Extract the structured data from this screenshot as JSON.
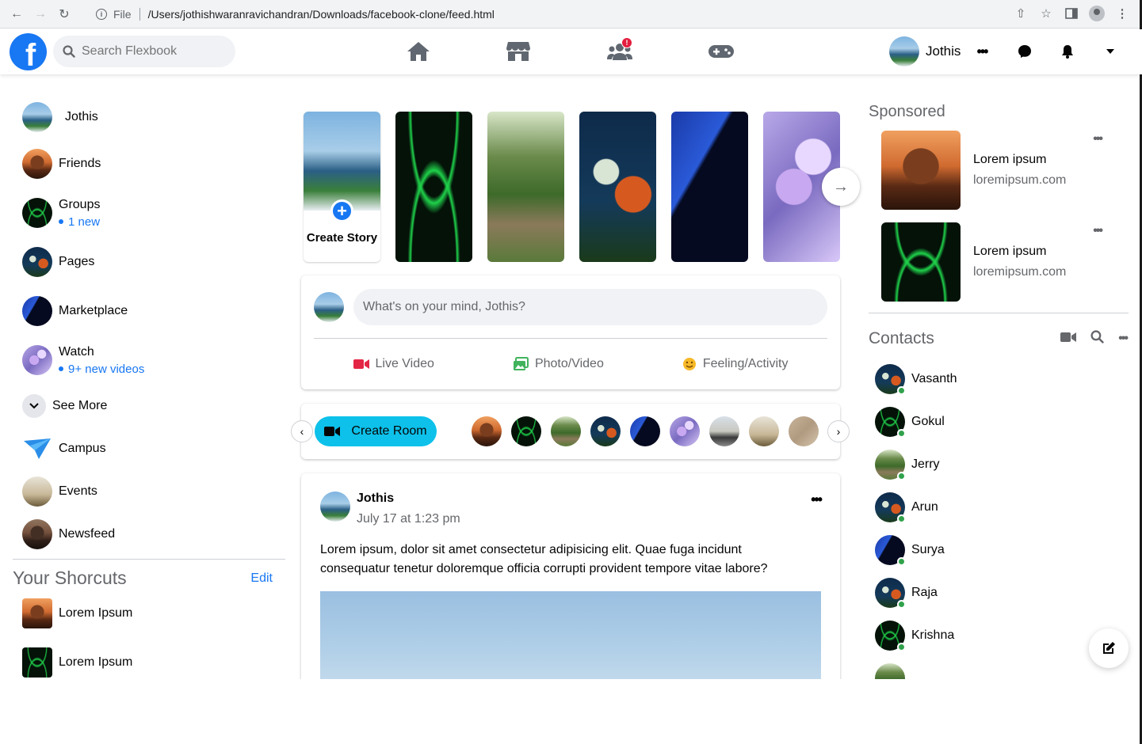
{
  "browser": {
    "protocol_label": "File",
    "url": "/Users/jothishwaranravichandran/Downloads/facebook-clone/feed.html"
  },
  "topnav": {
    "logo_letter": "f",
    "search_placeholder": "Search Flexbook",
    "groups_badge": "!",
    "profile_name": "Jothis",
    "brand_color": "#1877f2"
  },
  "left_menu": {
    "profile_name": "Jothis",
    "items": [
      {
        "label": "Friends"
      },
      {
        "label": "Groups",
        "sub": "1 new"
      },
      {
        "label": "Pages"
      },
      {
        "label": "Marketplace"
      },
      {
        "label": "Watch",
        "sub": "9+ new videos"
      }
    ],
    "see_more": "See More",
    "items2": [
      {
        "label": "Campus"
      },
      {
        "label": "Events"
      },
      {
        "label": "Newsfeed"
      }
    ],
    "shortcuts_title": "Your Shorcuts",
    "shortcuts_edit": "Edit",
    "shortcuts": [
      {
        "label": "Lorem Ipsum"
      },
      {
        "label": "Lorem Ipsum"
      }
    ]
  },
  "stories": {
    "create_label": "Create Story"
  },
  "composer": {
    "placeholder": "What's on your mind, Jothis?",
    "live_video": "Live Video",
    "photo_video": "Photo/Video",
    "feeling": "Feeling/Activity"
  },
  "rooms": {
    "create_room": "Create Room"
  },
  "post": {
    "author": "Jothis",
    "time": "July 17 at 1:23 pm",
    "text": "Lorem ipsum, dolor sit amet consectetur adipisicing elit. Quae fuga incidunt consequatur tenetur doloremque officia corrupti provident tempore vitae labore?"
  },
  "sponsored": {
    "title": "Sponsored",
    "ads": [
      {
        "title": "Lorem ipsum",
        "site": "loremipsum.com"
      },
      {
        "title": "Lorem ipsum",
        "site": "loremipsum.com"
      }
    ]
  },
  "contacts": {
    "title": "Contacts",
    "people": [
      {
        "name": "Vasanth"
      },
      {
        "name": "Gokul"
      },
      {
        "name": "Jerry"
      },
      {
        "name": "Arun"
      },
      {
        "name": "Surya"
      },
      {
        "name": "Raja"
      },
      {
        "name": "Krishna"
      }
    ]
  }
}
